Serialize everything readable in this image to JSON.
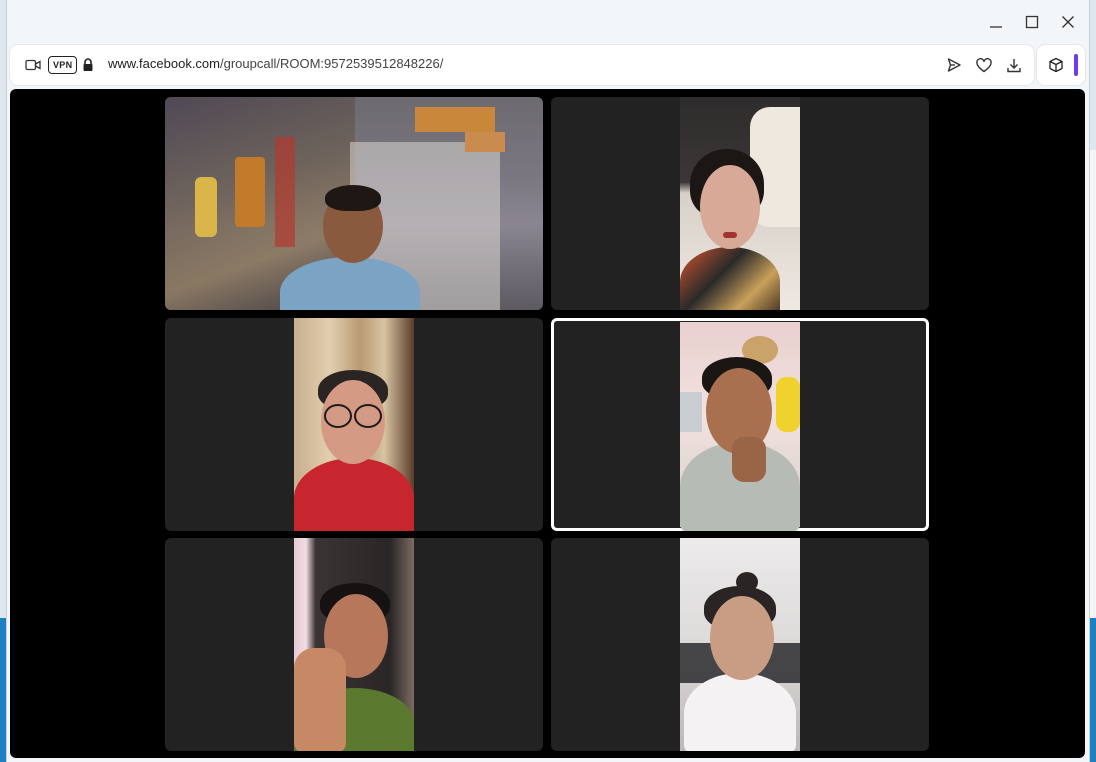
{
  "window": {
    "controls": {
      "minimize_glyph": "—",
      "maximize_glyph": "☐",
      "close_glyph": "✕"
    }
  },
  "addressbar": {
    "vpn_label": "VPN",
    "url_host": "www.facebook.com",
    "url_path": "/groupcall/ROOM:9572539512848226/",
    "icons": [
      "camera-icon",
      "lock-icon",
      "send-icon",
      "heart-icon",
      "download-icon"
    ]
  },
  "extensions": {
    "icons": [
      "cube-icon"
    ],
    "accent_color": "#6d3bf2"
  },
  "call": {
    "background_color": "#000000",
    "tile_color": "#222222",
    "active_border_color": "#ffffff",
    "participants": [
      {
        "id": "participant-1",
        "layout": "landscape",
        "active": false
      },
      {
        "id": "participant-2",
        "layout": "portrait",
        "active": false
      },
      {
        "id": "participant-3",
        "layout": "portrait",
        "active": false
      },
      {
        "id": "participant-4",
        "layout": "portrait",
        "active": true
      },
      {
        "id": "participant-5",
        "layout": "portrait",
        "active": false
      },
      {
        "id": "participant-6",
        "layout": "portrait",
        "active": false
      }
    ]
  }
}
